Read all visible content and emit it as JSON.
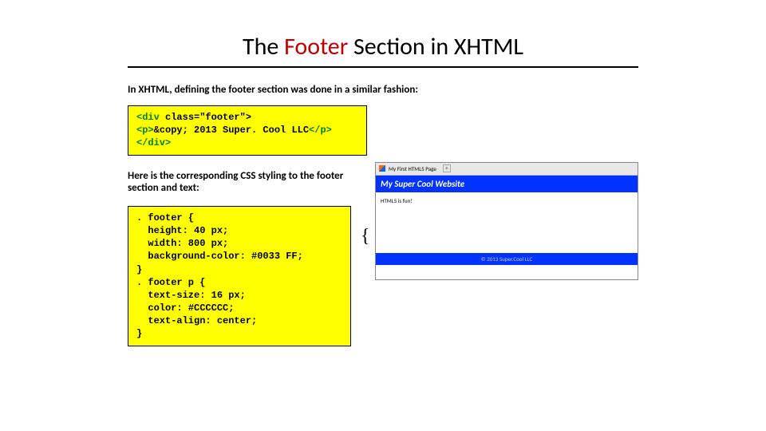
{
  "title": {
    "pre": "The ",
    "accent": "Footer ",
    "post": "Section in XHTML"
  },
  "intro": "In XHTML, defining the footer section was done in a similar fashion:",
  "code1": {
    "l1a": "<div",
    "l1b": " class=\"footer\">",
    "l2a": "  <p>",
    "l2b": "&copy; 2013 Super. Cool LLC",
    "l2c": "</p>",
    "l3": "</div>"
  },
  "para2": "Here is the corresponding CSS styling to the footer section and text:",
  "code2": ". footer {\n  height: 40 px;\n  width: 800 px;\n  background-color: #0033 FF;\n}\n. footer p {\n  text-size: 16 px;\n  color: #CCCCCC;\n  text-align: center;\n}",
  "browser": {
    "tab": "My First HTML5 Page",
    "plus": "+",
    "banner": "My Super Cool Website",
    "body": "HTML5 is fun!",
    "footer": "© 2013 Super.Cool LLC"
  },
  "brace": "{"
}
